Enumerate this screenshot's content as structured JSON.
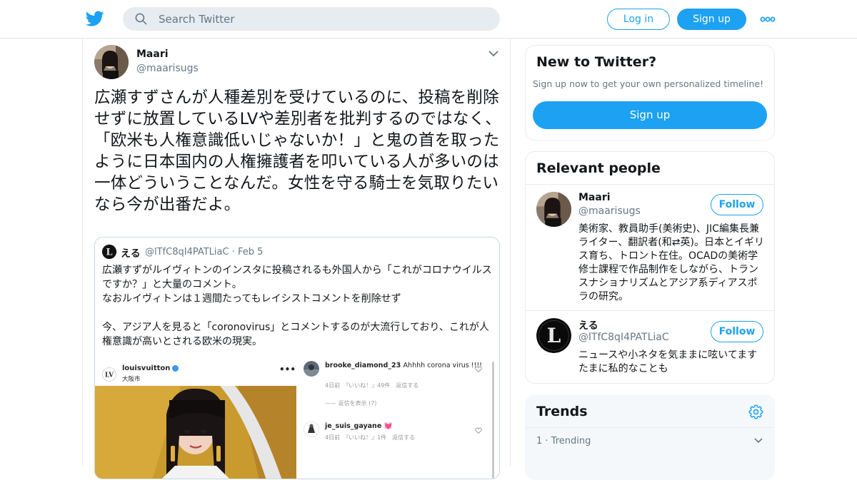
{
  "header": {
    "logo": "twitter-bird-icon",
    "search_placeholder": "Search Twitter",
    "login_label": "Log in",
    "signup_label": "Sign up",
    "more_icon": "more-dots-icon"
  },
  "tweet": {
    "name": "Maari",
    "handle": "@maarisugs",
    "text": "広瀬すずさんが人種差別を受けているのに、投稿を削除せずに放置しているLVや差別者を批判するのではなく、「欧米も人権意識低いじゃないか！」と鬼の首を取ったように日本国内の人権擁護者を叩いている人が多いのは一体どういうことなんだ。女性を守る騎士を気取りたいなら今が出番だよ。",
    "quote": {
      "name": "える",
      "handle_date": "@lTfC8qI4PATLiaC · Feb 5",
      "text": "広瀬すずがルイヴィトンのインスタに投稿されるも外国人から「これがコロナウイルスですか？」と大量のコメント。\nなおルイヴィトンは１週間たってもレイシストコメントを削除せず\n\n今、アジア人を見ると「coronovirus」とコメントするのが大流行しており、これが人権意識が高いとされる欧米の現実。",
      "media": {
        "account": "louisvuitton",
        "location": "大阪市",
        "more": "•••",
        "comments": [
          {
            "user": "brooke_diamond_23",
            "text": "Ahhhh corona virus !!!!",
            "meta": "4日前　『いいね！』49件　返信する"
          },
          {
            "user": "je_suis_gayane",
            "text": "💓",
            "meta": "4日前　『いいね！』1件　返信する"
          }
        ],
        "replies_label": "—— 返信を表示 (7)"
      }
    }
  },
  "new_to_twitter": {
    "title": "New to Twitter?",
    "subtitle": "Sign up now to get your own personalized timeline!",
    "button": "Sign up"
  },
  "relevant_people": {
    "title": "Relevant people",
    "people": [
      {
        "name": "Maari",
        "handle": "@maarisugs",
        "follow": "Follow",
        "bio": "美術家、教員助手(美術史)、JIC編集長兼ライター、翻訳者(和⇄英)。日本とイギリス育ち、トロント在住。OCADの美術学修士課程で作品制作をしながら、トランスナショナリズムとアジア系ディアスポラの研究。"
      },
      {
        "name": "える",
        "handle": "@lTfC8qI4PATLiaC",
        "follow": "Follow",
        "bio": "ニュースや小ネタを気ままに呟いてます たまに私的なことも"
      }
    ]
  },
  "trends": {
    "title": "Trends",
    "item": "1 · Trending"
  },
  "colors": {
    "brand": "#1da1f2",
    "text": "#14171a",
    "secondary": "#657786",
    "border": "#e6ecf0"
  }
}
